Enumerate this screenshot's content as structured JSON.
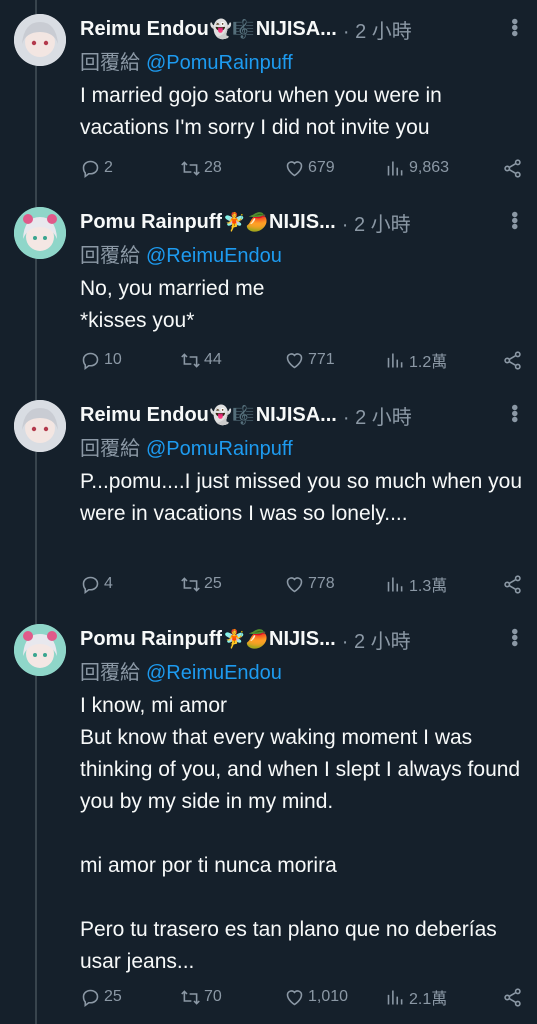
{
  "tweets": [
    {
      "author": "Reimu Endou",
      "emoji": "👻🎼",
      "author_suffix": "NIJISA...",
      "time": "· 2 小時",
      "reply_prefix": "回覆給",
      "reply_handle": "@PomuRainpuff",
      "text": "I married gojo satoru when you were in vacations I'm sorry I did not invite you",
      "replies": "2",
      "retweets": "28",
      "likes": "679",
      "views": "9,863",
      "avatar_icon": "reimu-avatar"
    },
    {
      "author": "Pomu Rainpuff",
      "emoji": "🧚🥭",
      "author_suffix": "NIJIS...",
      "time": "· 2 小時",
      "reply_prefix": "回覆給",
      "reply_handle": "@ReimuEndou",
      "text": "No, you married me\n*kisses you*",
      "replies": "10",
      "retweets": "44",
      "likes": "771",
      "views": "1.2萬",
      "avatar_icon": "pomu-avatar"
    },
    {
      "author": "Reimu Endou",
      "emoji": "👻🎼",
      "author_suffix": "NIJISA...",
      "time": "· 2 小時",
      "reply_prefix": "回覆給",
      "reply_handle": "@PomuRainpuff",
      "text": "P...pomu....I just missed you so much when you were in vacations I was so lonely....",
      "replies": "4",
      "retweets": "25",
      "likes": "778",
      "views": "1.3萬",
      "avatar_icon": "reimu-avatar"
    },
    {
      "author": "Pomu Rainpuff",
      "emoji": "🧚🥭",
      "author_suffix": "NIJIS...",
      "time": "· 2 小時",
      "reply_prefix": "回覆給",
      "reply_handle": "@ReimuEndou",
      "text": "I know, mi amor\nBut know that every waking moment I was thinking of you, and when I slept I always found you by my side in my mind.\n\nmi amor por ti nunca morira\n\nPero tu trasero es tan plano que no deberías usar jeans...",
      "replies": "25",
      "retweets": "70",
      "likes": "1,010",
      "views": "2.1萬",
      "avatar_icon": "pomu-avatar"
    }
  ],
  "colors": {
    "background": "#15202b",
    "text": "#f7f9f9",
    "muted": "#8b98a5",
    "link": "#1d9bf0"
  }
}
